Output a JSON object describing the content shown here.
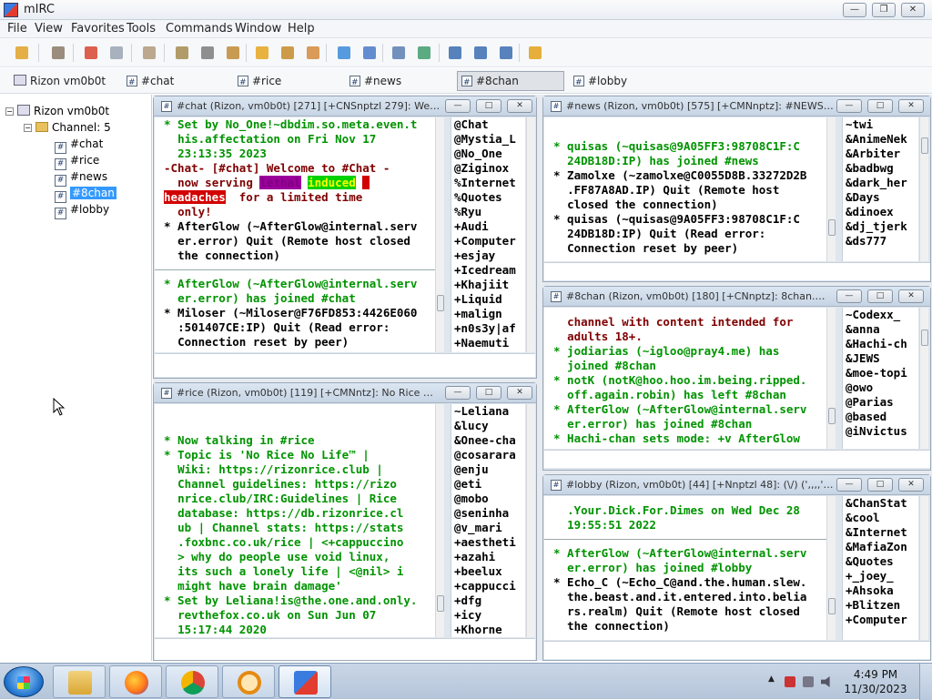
{
  "app": {
    "title": "mIRC"
  },
  "menu": [
    "File",
    "View",
    "Favorites",
    "Tools",
    "Commands",
    "Window",
    "Help"
  ],
  "toolbar": {
    "icons": [
      "connect-icon",
      "server-list-icon",
      "options-icon",
      "address-book-icon",
      "notify-icon",
      "channels-list-icon",
      "scripts-editor-icon",
      "timer-icon",
      "colors-icon",
      "send-file-icon",
      "chat-icon",
      "dcc-options-icon",
      "received-files-icon",
      "logs-icon",
      "url-list-icon",
      "tile-horizontal-icon",
      "tile-vertical-icon",
      "cascade-icon",
      "help-icon"
    ]
  },
  "switchbar": {
    "server": "Rizon vm0b0t",
    "tabs": [
      "#chat",
      "#rice",
      "#news",
      "#8chan",
      "#lobby"
    ],
    "active": "#8chan"
  },
  "tree": {
    "server": "Rizon vm0b0t",
    "group": "Channel: 5",
    "channels": [
      "#chat",
      "#rice",
      "#news",
      "#8chan",
      "#lobby"
    ],
    "selected": "#8chan"
  },
  "windows": {
    "chat": {
      "title": "#chat (Rizon, vm0b0t) [271] [+CNSnptzl 279]: Welco...",
      "messages": [
        {
          "c": "g",
          "t": "* Set by No_One!~dbdim.so.meta.even.t"
        },
        {
          "c": "g",
          "t": "  his.affectation on Fri Nov 17"
        },
        {
          "c": "g",
          "t": "  23:13:35 2023"
        },
        {
          "c": "r",
          "t": "-Chat- [#chat] Welcome to #Chat -"
        },
        {
          "c": "r",
          "t": "  now serving"
        },
        {
          "c": "r",
          "t": "  for a limited time"
        },
        {
          "c": "r",
          "t": "  only!"
        },
        {
          "c": "n",
          "t": "* AfterGlow (~AfterGlow@internal.serv"
        },
        {
          "c": "n",
          "t": "  er.error) Quit (Remote host closed"
        },
        {
          "c": "n",
          "t": "  the connection)"
        },
        {
          "c": "g",
          "t": "* AfterGlow (~AfterGlow@internal.serv"
        },
        {
          "c": "g",
          "t": "  er.error) has joined #chat"
        },
        {
          "c": "n",
          "t": "* Miloser (~Miloser@F76FD853:4426E060"
        },
        {
          "c": "n",
          "t": "  :501407CE:IP) Quit (Read error:"
        },
        {
          "c": "n",
          "t": "  Connection reset by peer)"
        }
      ],
      "highlights": [
        "lethal",
        "induced",
        "headaches"
      ],
      "nicks": [
        "@Chat",
        "@Mystia_L",
        "@No_One",
        "@Ziginox",
        "%Internet",
        "%Quotes",
        "%Ryu",
        "+Audi",
        "+Computer",
        "+esjay",
        "+Icedream",
        "+Khajiit",
        "+Liquid",
        "+malign",
        "+n0s3y|af",
        "+Naemuti"
      ]
    },
    "rice": {
      "title": "#rice (Rizon, vm0b0t) [119] [+CMNntz]: No Rice No L...",
      "messages": [
        {
          "c": "g",
          "t": "* Now talking in #rice"
        },
        {
          "c": "g",
          "t": "* Topic is 'No Rice No Life™ |"
        },
        {
          "c": "g",
          "t": "  Wiki: https://rizonrice.club |"
        },
        {
          "c": "g",
          "t": "  Channel guidelines: https://rizo"
        },
        {
          "c": "g",
          "t": "  nrice.club/IRC:Guidelines | Rice"
        },
        {
          "c": "g",
          "t": "  database: https://db.rizonrice.cl"
        },
        {
          "c": "g",
          "t": "  ub | Channel stats: https://stats"
        },
        {
          "c": "g",
          "t": "  .foxbnc.co.uk/rice | <+cappuccino"
        },
        {
          "c": "g",
          "t": "  > why do people use void linux,"
        },
        {
          "c": "g",
          "t": "  its such a lonely life | <@nil> i"
        },
        {
          "c": "g",
          "t": "  might have brain damage'"
        },
        {
          "c": "g",
          "t": "* Set by Leliana!is@the.one.and.only."
        },
        {
          "c": "g",
          "t": "  revthefox.co.uk on Sun Jun 07"
        },
        {
          "c": "g",
          "t": "  15:17:44 2020"
        }
      ],
      "nicks": [
        "~Leliana",
        "&lucy",
        "&Onee-cha",
        "@cosarara",
        "@enju",
        "@eti",
        "@mobo",
        "@seninha",
        "@v_mari",
        "+aestheti",
        "+azahi",
        "+beelux",
        "+cappucci",
        "+dfg",
        "+icy",
        "+Khorne"
      ]
    },
    "news": {
      "title": "#news (Rizon, vm0b0t) [575] [+CMNnptz]: #NEWS - |...",
      "messages": [
        {
          "c": "g",
          "t": "* quisas (~quisas@9A05FF3:98708C1F:C"
        },
        {
          "c": "g",
          "t": "  24DB18D:IP) has joined #news"
        },
        {
          "c": "n",
          "t": "* Zamolxe (~zamolxe@C0055D8B.33272D2B"
        },
        {
          "c": "n",
          "t": "  .FF87A8AD.IP) Quit (Remote host"
        },
        {
          "c": "n",
          "t": "  closed the connection)"
        },
        {
          "c": "n",
          "t": "* quisas (~quisas@9A05FF3:98708C1F:C"
        },
        {
          "c": "n",
          "t": "  24DB18D:IP) Quit (Read error:"
        },
        {
          "c": "n",
          "t": "  Connection reset by peer)"
        }
      ],
      "nicks": [
        "~twi",
        "&AnimeNek",
        "&Arbiter",
        "&badbwg",
        "&dark_her",
        "&Days",
        "&dinoex",
        "&dj_tjerk",
        "&ds777"
      ]
    },
    "8chan": {
      "title": "#8chan (Rizon, vm0b0t) [180] [+CNnptz]: 8chan.moe...",
      "messages": [
        {
          "c": "r",
          "t": "  channel with content intended for"
        },
        {
          "c": "r",
          "t": "  adults 18+."
        },
        {
          "c": "g",
          "t": "* jodiarias (~igloo@pray4.me) has"
        },
        {
          "c": "g",
          "t": "  joined #8chan"
        },
        {
          "c": "nv",
          "t": "* notK (notK@hoo.hoo.im.being.ripped."
        },
        {
          "c": "nv",
          "t": "  off.again.robin) has left #8chan"
        },
        {
          "c": "g",
          "t": "* AfterGlow (~AfterGlow@internal.serv"
        },
        {
          "c": "g",
          "t": "  er.error) has joined #8chan"
        },
        {
          "c": "g",
          "t": "* Hachi-chan sets mode: +v AfterGlow"
        }
      ],
      "nicks": [
        "~Codexx_",
        "&anna",
        "&Hachi-ch",
        "&JEWS",
        "&moe-topi",
        "@owo",
        "@Parias",
        "@based",
        "@iNvictus"
      ]
    },
    "lobby": {
      "title": "#lobby (Rizon, vm0b0t) [44] [+Nnptzl 48]: (\\/) (',,,,') (...",
      "messages": [
        {
          "c": "g",
          "t": "  .Your.Dick.For.Dimes on Wed Dec 28"
        },
        {
          "c": "g",
          "t": "  19:55:51 2022"
        },
        {
          "c": "g",
          "t": "* AfterGlow (~AfterGlow@internal.serv"
        },
        {
          "c": "g",
          "t": "  er.error) has joined #lobby"
        },
        {
          "c": "n",
          "t": "* Echo_C (~Echo_C@and.the.human.slew."
        },
        {
          "c": "n",
          "t": "  the.beast.and.it.entered.into.belia"
        },
        {
          "c": "n",
          "t": "  rs.realm) Quit (Remote host closed"
        },
        {
          "c": "n",
          "t": "  the connection)"
        }
      ],
      "nicks": [
        "&ChanStat",
        "&cool",
        "&Internet",
        "&MafiaZon",
        "&Quotes",
        "+_joey_",
        "+Ahsoka",
        "+Blitzen",
        "+Computer"
      ]
    }
  },
  "taskbar": {
    "time": "4:49 PM",
    "date": "11/30/2023",
    "apps": [
      "file-explorer-icon",
      "firefox-icon",
      "chrome-icon",
      "search-everything-icon",
      "mirc-icon"
    ]
  },
  "colors": {
    "green": "#009300",
    "maroon": "#7f0000",
    "navy": "#000080",
    "select": "#3399ff"
  }
}
